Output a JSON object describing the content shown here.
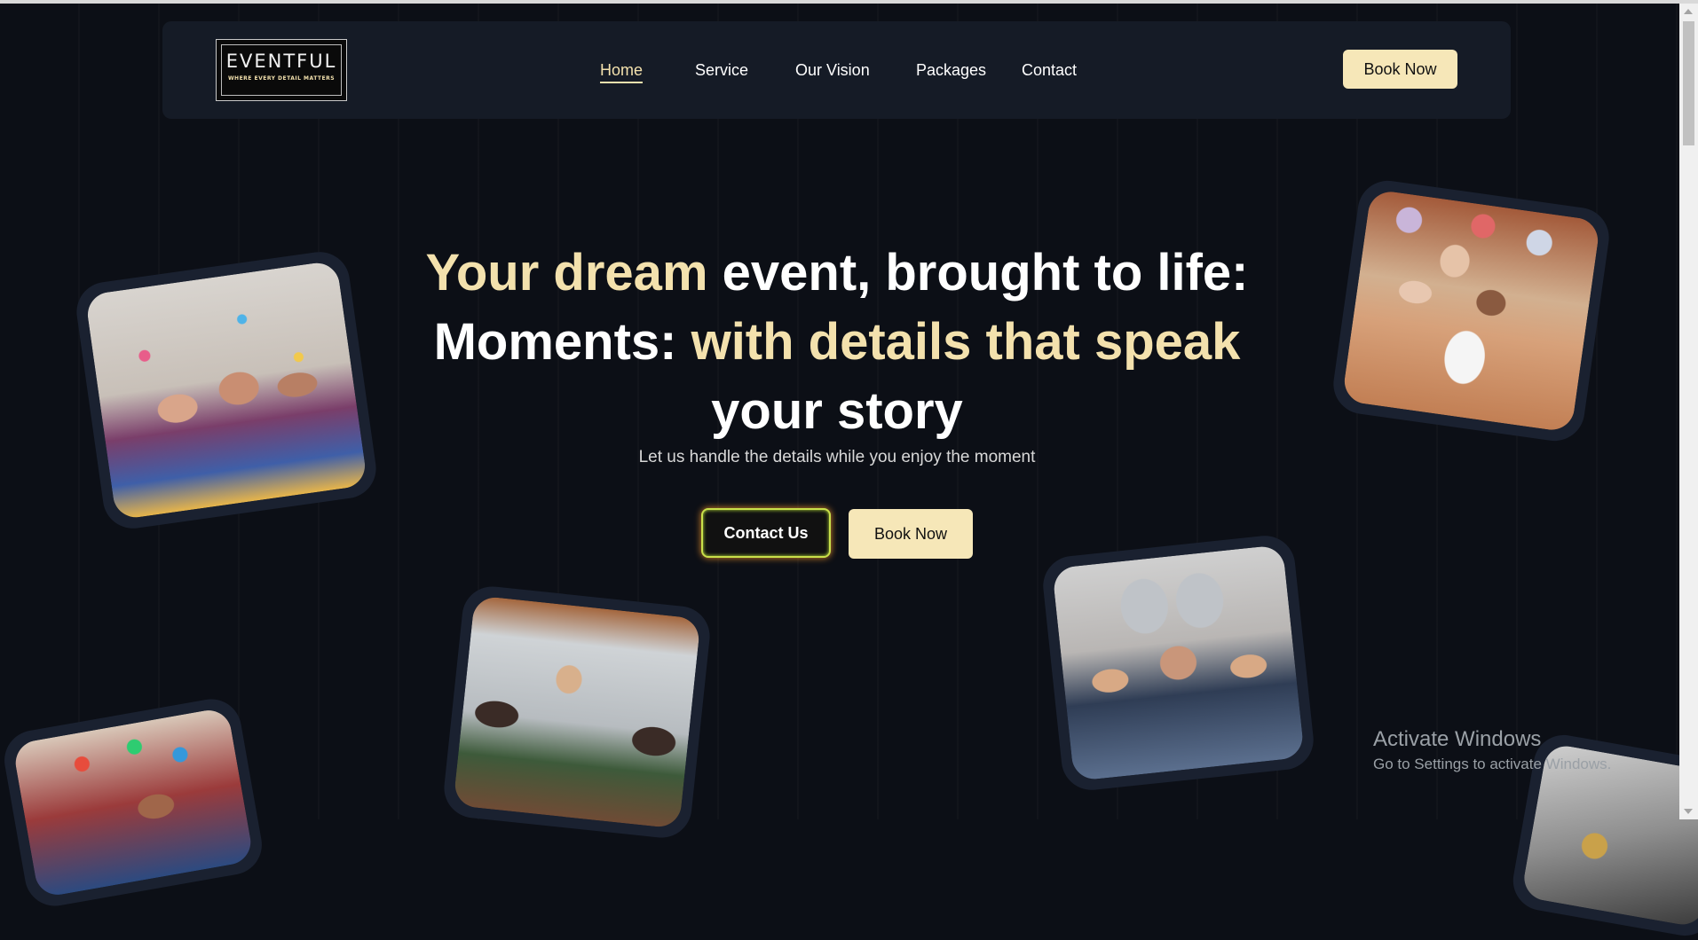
{
  "nav": {
    "logo_title": "EVENTFUL",
    "logo_tagline": "WHERE EVERY DETAIL MATTERS",
    "links": [
      {
        "label": "Home",
        "active": true
      },
      {
        "label": "Service",
        "active": false
      },
      {
        "label": "Our Vision",
        "active": false
      },
      {
        "label": "Packages",
        "active": false
      },
      {
        "label": "Contact",
        "active": false
      }
    ],
    "book_button": "Book Now"
  },
  "hero": {
    "title_part1": "Your dream",
    "title_part2": " event, brought to life:",
    "title_part3": "Moments: ",
    "title_part4": "with details that speak",
    "title_part5": "your story",
    "subtitle": "Let us handle the details while you enjoy the moment",
    "contact_button": "Contact Us",
    "book_button": "Book Now"
  },
  "photos": [
    "party-confetti-photo",
    "family-birthday-photo",
    "outdoor-dinner-photo",
    "sweet-16-party-photo",
    "kids-party-photo",
    "party-detail-photo"
  ],
  "os_overlay": {
    "line1": "Activate Windows",
    "line2": "Go to Settings to activate Windows."
  },
  "colors": {
    "background": "#0c0f16",
    "navbar": "#151b26",
    "accent_gold": "#f3e1ad",
    "button_cream": "#f6e7b8"
  }
}
